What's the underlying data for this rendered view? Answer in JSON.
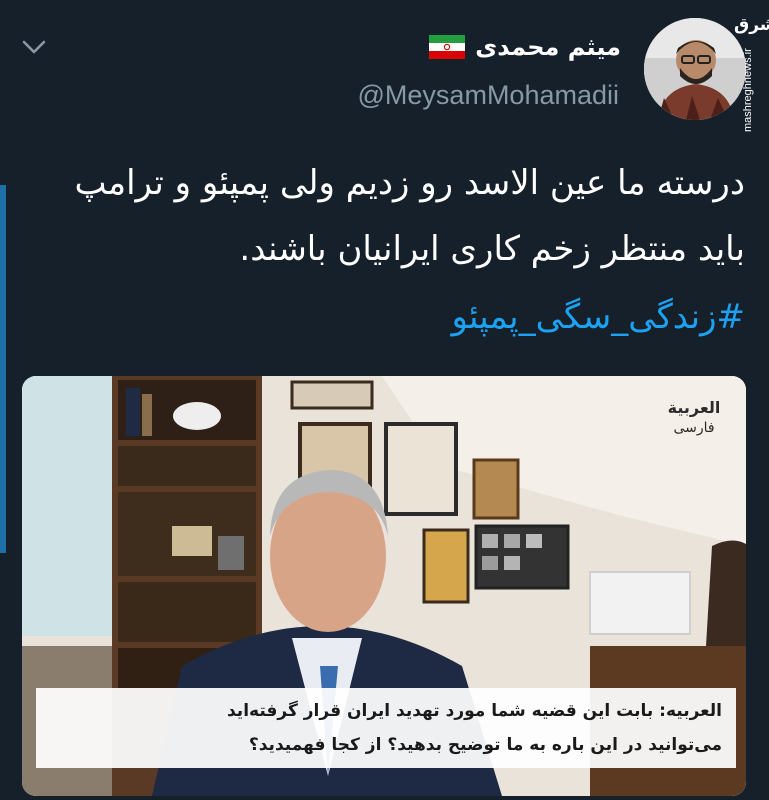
{
  "tweet": {
    "display_name": "میثم محمدی",
    "handle": "@MeysamMohamadii",
    "text": "درسته ما عین الاسد رو زدیم ولی پمپئو و ترامپ باید منتظر زخم کاری ایرانیان باشند.",
    "hashtag": "#زندگی_سگی_پمپئو",
    "flag_icon": "iran-flag-icon",
    "menu_icon": "chevron-down-icon"
  },
  "watermark": {
    "logo": "مشرق",
    "url": "mashreghnews.ir"
  },
  "media": {
    "channel_logo_line1": "العربية",
    "channel_logo_line2": "فارسی",
    "caption_line1": "العربیه: بابت این قضیه شما مورد تهدید ایران قرار گرفته‌اید",
    "caption_line2": "می‌توانید در این باره به ما توضیح بدهید؟ از کجا فهمیدید؟"
  },
  "colors": {
    "background": "#15202b",
    "text": "#ffffff",
    "handle": "#8899a6",
    "hashtag": "#1da1f2",
    "accent_bar": "#1f6fa8"
  }
}
